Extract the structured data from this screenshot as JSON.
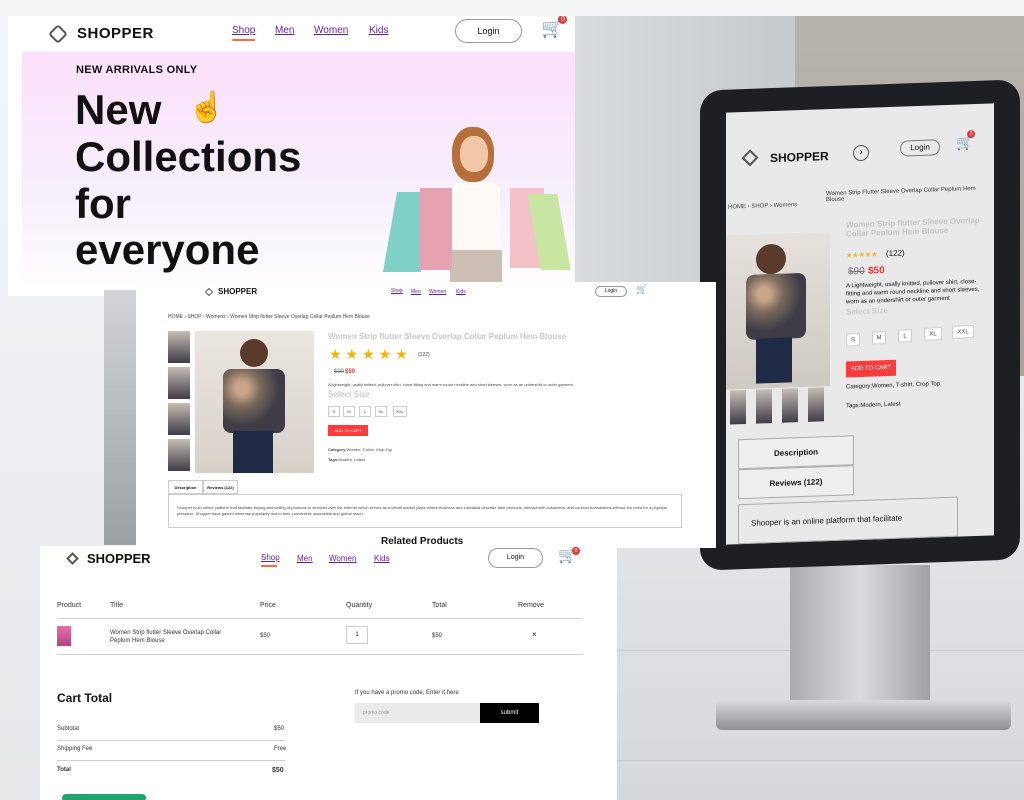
{
  "brand": "SHOPPER",
  "nav": {
    "shop": "Shop",
    "men": "Men",
    "women": "Women",
    "kids": "Kids",
    "login": "Login",
    "cart_count": "0"
  },
  "hero": {
    "eyebrow": "NEW ARRIVALS ONLY",
    "line1": "New",
    "line2": "Collections",
    "line3": "for",
    "line4": "everyone"
  },
  "product_page": {
    "breadcrumb": {
      "home": "HOME",
      "shop": "SHOP",
      "category": "Womens",
      "current": "Women Strip flutter Sleeve Overlap Collar Peplum Hem Blouse"
    },
    "title": "Women Strip flutter Sleeve Overlap Collar Peplum Hem Blouse",
    "stars": "★★★★★",
    "review_count": "(122)",
    "old_price": "$90",
    "new_price": "$50",
    "description": "A lightweight, usally knitted, pullover shirt, close-fitting and warm round neckline and short sleeves, worn as an undershirt or outer garment",
    "select_size": "Select Size",
    "sizes": [
      "S",
      "M",
      "L",
      "XL",
      "XXL"
    ],
    "add_to_cart": "ADD TO CART",
    "category_label": "Category:",
    "category_value": "Women, T-shirt, Crop Top",
    "tags_label": "Tags:",
    "tags_value": "Modern, Latest",
    "tab_description": "Description",
    "tab_reviews": "Reviews (122)",
    "desc_text": "Shooper is an online platform that facilitate buying and selling of products or services over the internet which serves as a virtual market place where business and individual describe their products, interact with customers, and conduct transactions without the need for a physical presence. Shopper have gained immense popularity due to their convenient, accessible and global reach",
    "related": "Related Products"
  },
  "cart_page": {
    "headers": {
      "product": "Product",
      "title": "Title",
      "price": "Price",
      "quantity": "Quantity",
      "total": "Total",
      "remove": "Remove"
    },
    "row": {
      "title_line1": "Women Strip flutter Sleeve Overlap Collar",
      "title_line2": "Peplum Hem Blouse",
      "price": "$50",
      "quantity": "1",
      "total": "$50",
      "remove": "×"
    },
    "cart_total": "Cart Total",
    "subtotal_label": "Subtotal",
    "subtotal_value": "$50",
    "shipping_label": "Shipping Fee",
    "shipping_value": "Free",
    "total_label": "Total",
    "total_value": "$50",
    "promo_hint": "If you have a promo code, Enter it here",
    "promo_placeholder": "promo code",
    "submit": "submit"
  },
  "kiosk": {
    "brand": "SHOPPER",
    "login": "Login",
    "cart_count": "1",
    "bc_home": "HOME",
    "bc_shop": "SHOP",
    "bc_cat": "Womens",
    "bc_current": "Women Strip Flutter Sleeve Overlap Collar Peplum Hem Blouse",
    "title": "Women Strip flutter Sleeve Overlap Collar Peplum Hem Blouse",
    "stars": "★★★★★",
    "reviews": "(122)",
    "old_price": "$90",
    "new_price": "$50",
    "desc": "A Lightweight, usally knitted, pullover shirt, close-fitting and warm round neckline and short sleeves, worn as an undershirt or outer garment",
    "select_size": "Select Size",
    "sizes": [
      "S",
      "M",
      "L",
      "XL",
      "XXL"
    ],
    "add_to_cart": "ADD TO CART",
    "category": "Category:Women, T-shirt, Crop Top",
    "tags": "Tags:Modern, Latest",
    "tab_desc": "Description",
    "tab_reviews": "Reviews (122)",
    "desc_text": "Shooper is an online platform that facilitate"
  }
}
